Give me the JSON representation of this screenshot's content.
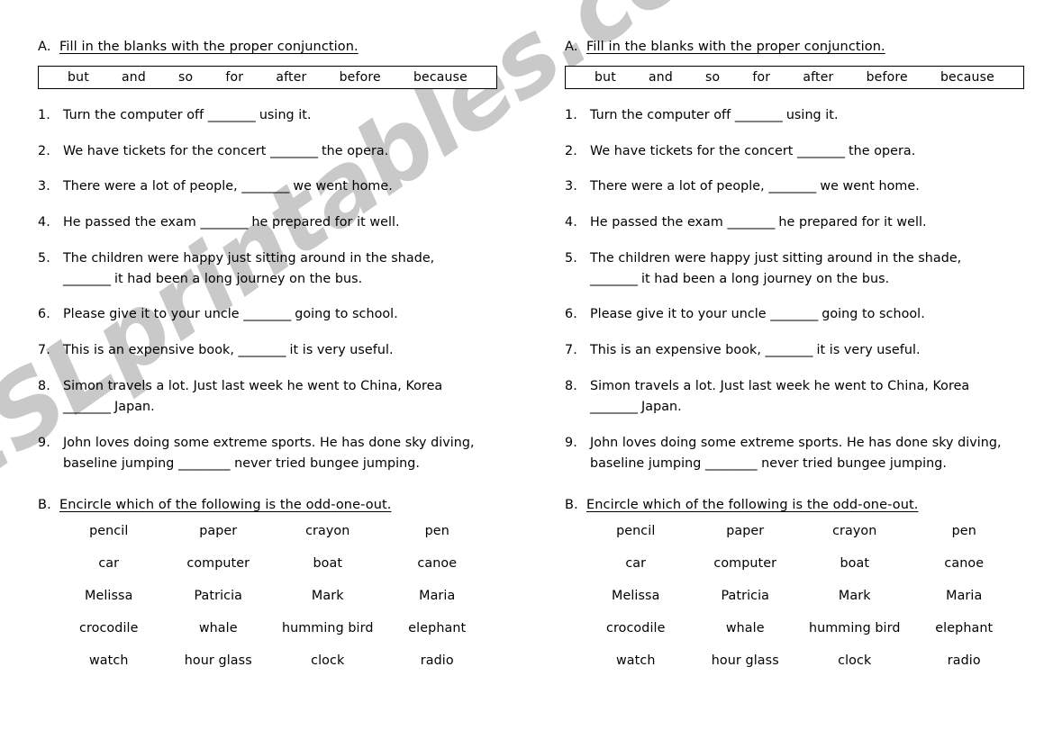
{
  "watermark": {
    "text": "ESLprintables.com",
    "color": "#c9c9c9"
  },
  "page": {
    "background": "#ffffff",
    "ink": "#000000",
    "columns": 2,
    "note": "The left and right columns are identical duplicates of the same worksheet."
  },
  "worksheet": {
    "section_a": {
      "letter": "A.",
      "title": "Fill in the blanks with the proper conjunction.",
      "word_bank": [
        "but",
        "and",
        "so",
        "for",
        "after",
        "before",
        "because"
      ],
      "questions": [
        {
          "number": "1.",
          "line1_before": "Turn the computer off ",
          "blank": "________",
          "line1_after": " using it.",
          "line2_blank": "",
          "line2_after": ""
        },
        {
          "number": "2.",
          "line1_before": "We have tickets for the concert ",
          "blank": "________",
          "line1_after": " the opera.",
          "line2_blank": "",
          "line2_after": ""
        },
        {
          "number": "3.",
          "line1_before": "There were a lot of people, ",
          "blank": "________",
          "line1_after": " we went home.",
          "line2_blank": "",
          "line2_after": ""
        },
        {
          "number": "4.",
          "line1_before": "He passed the exam ",
          "blank": "________",
          "line1_after": " he prepared for it well.",
          "line2_blank": "",
          "line2_after": ""
        },
        {
          "number": "5.",
          "line1_before": "The children were happy just sitting around in the shade,",
          "blank": "",
          "line1_after": "",
          "line2_blank": "________",
          "line2_after": " it had been a long journey on the bus."
        },
        {
          "number": "6.",
          "line1_before": "Please give it to your uncle ",
          "blank": "________",
          "line1_after": " going to school.",
          "line2_blank": "",
          "line2_after": ""
        },
        {
          "number": "7.",
          "line1_before": "This is an expensive book, ",
          "blank": "________",
          "line1_after": " it is very useful.",
          "line2_blank": "",
          "line2_after": ""
        },
        {
          "number": "8.",
          "line1_before": "Simon travels a lot.  Just last week he went to China, Korea",
          "blank": "",
          "line1_after": "",
          "line2_blank": "________",
          "line2_after": "  Japan."
        },
        {
          "number": "9.",
          "line1_before": "John loves doing some extreme sports.  He has done sky diving,",
          "blank": "",
          "line1_after": "",
          "line2_blank": "",
          "line2_after": "baseline jumping ________ never tried bungee jumping."
        }
      ]
    },
    "section_b": {
      "letter": "B.",
      "title": "Encircle which of the following is the odd-one-out.",
      "word_rows": [
        [
          "pencil",
          "paper",
          "crayon",
          "pen"
        ],
        [
          "car",
          "computer",
          "boat",
          "canoe"
        ],
        [
          "Melissa",
          "Patricia",
          "Mark",
          "Maria"
        ],
        [
          "crocodile",
          "whale",
          "humming bird",
          "elephant"
        ],
        [
          "watch",
          "hour glass",
          "clock",
          "radio"
        ]
      ]
    }
  }
}
